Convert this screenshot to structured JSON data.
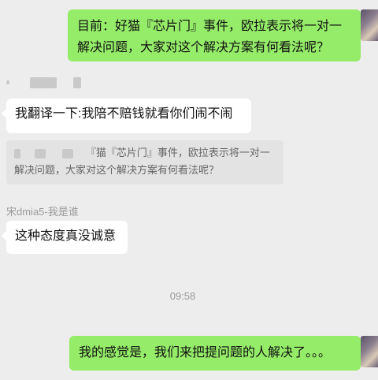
{
  "messages": {
    "msg1": {
      "text": "目前：好猫『芯片门』事件，欧拉表示将一对一解决问题，大家对这个解决方案有何看法呢？"
    },
    "msg2": {
      "text": "我翻译一下:我陪不赔钱就看你们闹不闹"
    },
    "quote": {
      "text": "『猫『芯片门』事件，欧拉表示将一对一解决问题，大家对这个解决方案有何看法呢？"
    },
    "sender2": "宋dmia5-我是谁",
    "msg3": {
      "text": "这种态度真没诚意"
    },
    "timestamp": "09:58",
    "msg4": {
      "text": "我的感觉是，我们来把提问题的人解决了。。。"
    }
  }
}
